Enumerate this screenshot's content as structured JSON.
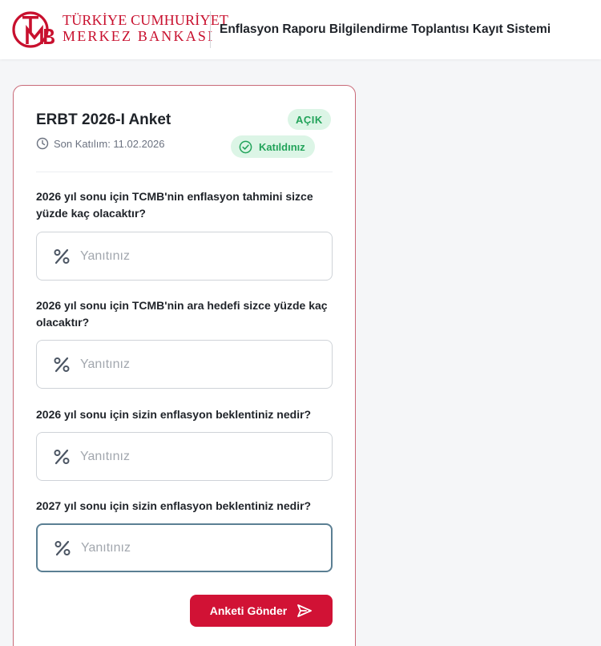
{
  "header": {
    "logo_line1": "TÜRKİYE CUMHURİYET",
    "logo_line2": "MERKEZ BANKASI",
    "title": "Enflasyon Raporu Bilgilendirme Toplantısı Kayıt Sistemi"
  },
  "survey": {
    "title": "ERBT 2026-I Anket",
    "deadline": "Son Katılım: 11.02.2026",
    "status_badge": "AÇIK",
    "joined_badge": "Katıldınız",
    "questions": [
      {
        "label": "2026 yıl sonu için TCMB'nin enflasyon tahmini sizce yüzde kaç olacaktır?",
        "placeholder": "Yanıtınız",
        "value": ""
      },
      {
        "label": "2026 yıl sonu için TCMB'nin ara hedefi sizce yüzde kaç olacaktır?",
        "placeholder": "Yanıtınız",
        "value": ""
      },
      {
        "label": "2026 yıl sonu için sizin enflasyon beklentiniz nedir?",
        "placeholder": "Yanıtınız",
        "value": ""
      },
      {
        "label": "2027 yıl sonu için sizin enflasyon beklentiniz nedir?",
        "placeholder": "Yanıtınız",
        "value": ""
      }
    ],
    "submit_label": "Anketi Gönder"
  },
  "icons": {
    "logo": "tcmb-logo-icon",
    "deadline": "clock-icon",
    "joined": "check-circle-icon",
    "answer": "percent-icon",
    "submit": "send-icon"
  },
  "colors": {
    "brand_red": "#c8102e",
    "button_red": "#d11235",
    "success_green": "#22a35a",
    "success_bg": "#dcf5e6",
    "card_border": "#c96a78",
    "focus_border": "#5b7f93"
  }
}
